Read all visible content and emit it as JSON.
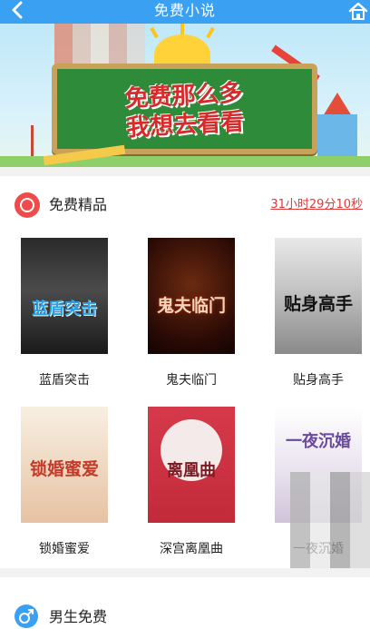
{
  "header": {
    "title": "免费小说"
  },
  "banner": {
    "text_line1": "免费那么多",
    "text_line2": "我想去看看"
  },
  "free_section": {
    "title": "免费精品",
    "countdown": "31小时29分10秒",
    "books": [
      {
        "title": "蓝盾突击",
        "cover_text": "蓝盾突击"
      },
      {
        "title": "鬼夫临门",
        "cover_text": "鬼夫临门"
      },
      {
        "title": "贴身高手",
        "cover_text": "贴身高手"
      },
      {
        "title": "锁婚蜜爱",
        "cover_text": "锁婚蜜爱"
      },
      {
        "title": "深宫离凰曲",
        "cover_text": "离凰曲"
      },
      {
        "title": "一夜沉婚",
        "cover_text": "一夜沉婚"
      }
    ]
  },
  "male_section": {
    "title": "男生免费"
  },
  "icons": {
    "back": "back-arrow-icon",
    "home": "home-icon",
    "free_section": "free-badge-icon",
    "male_section": "male-icon"
  },
  "colors": {
    "primary": "#3aa0f2",
    "accent_red": "#ef4b4b",
    "countdown_red": "#e03a3a"
  }
}
